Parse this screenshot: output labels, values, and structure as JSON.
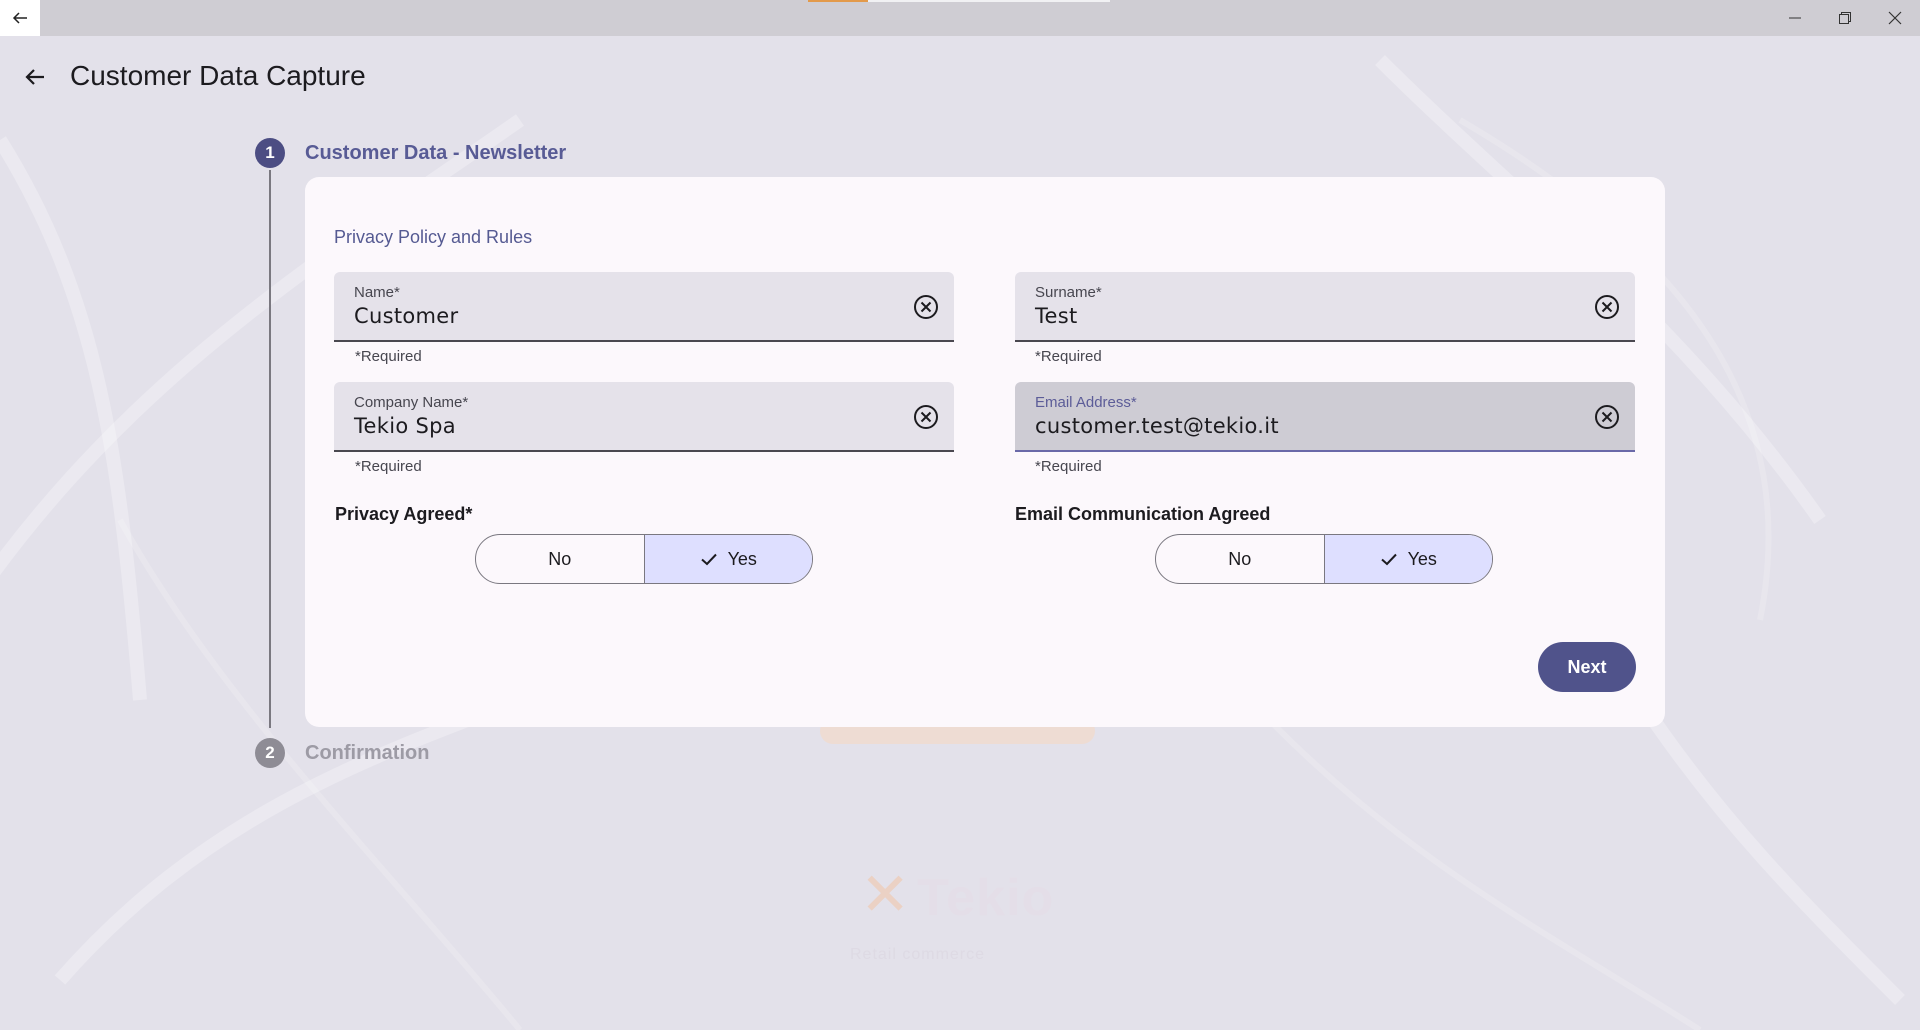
{
  "app": {
    "title": "Customer Data Capture"
  },
  "stepper": {
    "steps": [
      {
        "number": "1",
        "label": "Customer Data - Newsletter",
        "state": "active"
      },
      {
        "number": "2",
        "label": "Confirmation",
        "state": "inactive"
      }
    ]
  },
  "form": {
    "section_title": "Privacy Policy and Rules",
    "fields": {
      "name": {
        "label": "Name*",
        "value": "Customer",
        "helper": "*Required"
      },
      "surname": {
        "label": "Surname*",
        "value": "Test",
        "helper": "*Required"
      },
      "company": {
        "label": "Company Name*",
        "value": "Tekio Spa",
        "helper": "*Required"
      },
      "email": {
        "label": "Email Address*",
        "value": "customer.test@tekio.it",
        "helper": "*Required",
        "focused": true
      }
    },
    "toggles": {
      "privacy": {
        "title": "Privacy Agreed*",
        "options": [
          "No",
          "Yes"
        ],
        "selected": "Yes"
      },
      "email_comm": {
        "title": "Email Communication Agreed",
        "options": [
          "No",
          "Yes"
        ],
        "selected": "Yes"
      }
    },
    "next_label": "Next"
  },
  "background": {
    "logo_text": "Tekio",
    "tagline": "Retail commerce"
  },
  "colors": {
    "primary": "#4c4d83",
    "accent_label": "#585b95",
    "selected_segment": "#dedfff",
    "background": "#e3e1ea",
    "card": "#fcf8fc",
    "progress_orange": "#e39a4b"
  },
  "icons": {
    "titlebar_back": "arrow-left-icon",
    "minimize": "minimize-icon",
    "maximize": "restore-icon",
    "close": "close-icon",
    "app_back": "arrow-left-icon",
    "clear": "clear-circle-icon",
    "check": "check-icon"
  }
}
